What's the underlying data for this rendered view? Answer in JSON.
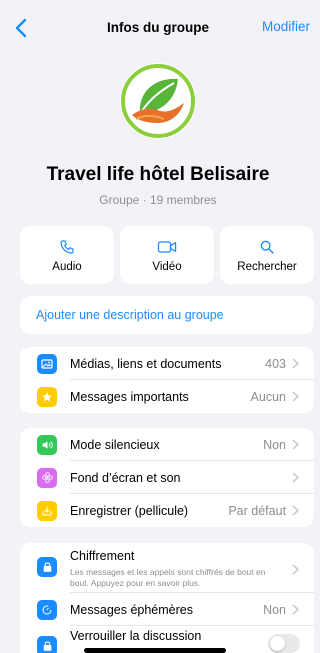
{
  "nav": {
    "title": "Infos du groupe",
    "edit_label": "Modifier"
  },
  "group": {
    "name": "Travel life hôtel Belisaire",
    "subtitle": "Groupe · 19 membres"
  },
  "actions": [
    {
      "label": "Audio",
      "icon": "phone-icon"
    },
    {
      "label": "Vidéo",
      "icon": "video-icon"
    },
    {
      "label": "Rechercher",
      "icon": "search-icon"
    }
  ],
  "description_link": "Ajouter une description au groupe",
  "section1": [
    {
      "label": "Médias, liens et documents",
      "value": "403",
      "icon": "photo-icon",
      "color": "#1a8cff"
    },
    {
      "label": "Messages importants",
      "value": "Aucun",
      "icon": "star-icon",
      "color": "#ffcc00"
    }
  ],
  "section2": [
    {
      "label": "Mode silencieux",
      "value": "Non",
      "icon": "speaker-icon",
      "color": "#34c759"
    },
    {
      "label": "Fond d’écran et son",
      "value": "",
      "icon": "flower-icon",
      "color": "#d96cf0"
    },
    {
      "label": "Enregistrer (pellicule)",
      "value": "Par défaut",
      "icon": "download-icon",
      "color": "#ffcc00"
    }
  ],
  "section3": {
    "encryption": {
      "label": "Chiffrement",
      "sub": "Les messages et les appels sont chiffrés de bout en bout. Appuyez pour en savoir plus.",
      "icon": "lock-icon",
      "color": "#1a8cff"
    },
    "ephemeral": {
      "label": "Messages éphémères",
      "value": "Non",
      "icon": "timer-icon",
      "color": "#1a8cff"
    },
    "lock_chat": {
      "label": "Verrouiller la discussion",
      "icon": "lock-chat-icon",
      "color": "#1a8cff",
      "enabled": false
    }
  },
  "colors": {
    "accent": "#1a8cff",
    "background": "#f2f2f7",
    "secondary_text": "#8e8e93"
  }
}
